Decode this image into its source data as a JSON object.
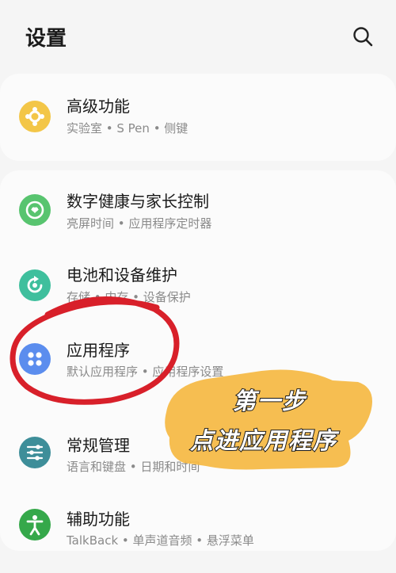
{
  "header": {
    "title": "设置",
    "search_icon": "search-icon"
  },
  "items": [
    {
      "label": "高级功能",
      "sub": "实验室 • S Pen • 侧键",
      "icon": "advanced-features-icon",
      "color": "#f3c648"
    },
    {
      "label": "数字健康与家长控制",
      "sub": "亮屏时间 • 应用程序定时器",
      "icon": "digital-wellbeing-icon",
      "color": "#58c46f"
    },
    {
      "label": "电池和设备维护",
      "sub": "存储 • 内存 • 设备保护",
      "icon": "device-care-icon",
      "color": "#3fbf9d"
    },
    {
      "label": "应用程序",
      "sub": "默认应用程序 • 应用程序设置",
      "icon": "apps-icon",
      "color": "#5b8dee"
    },
    {
      "label": "常规管理",
      "sub": "语言和键盘 • 日期和时间",
      "icon": "general-management-icon",
      "color": "#3e8e99"
    },
    {
      "label": "辅助功能",
      "sub": "TalkBack • 单声道音频 • 悬浮菜单",
      "icon": "accessibility-icon",
      "color": "#35a84a"
    }
  ],
  "annotation": {
    "line1": "第一步",
    "line2": "点进应用程序",
    "circle_color": "#d8202a",
    "highlight_color": "#f5b942"
  }
}
